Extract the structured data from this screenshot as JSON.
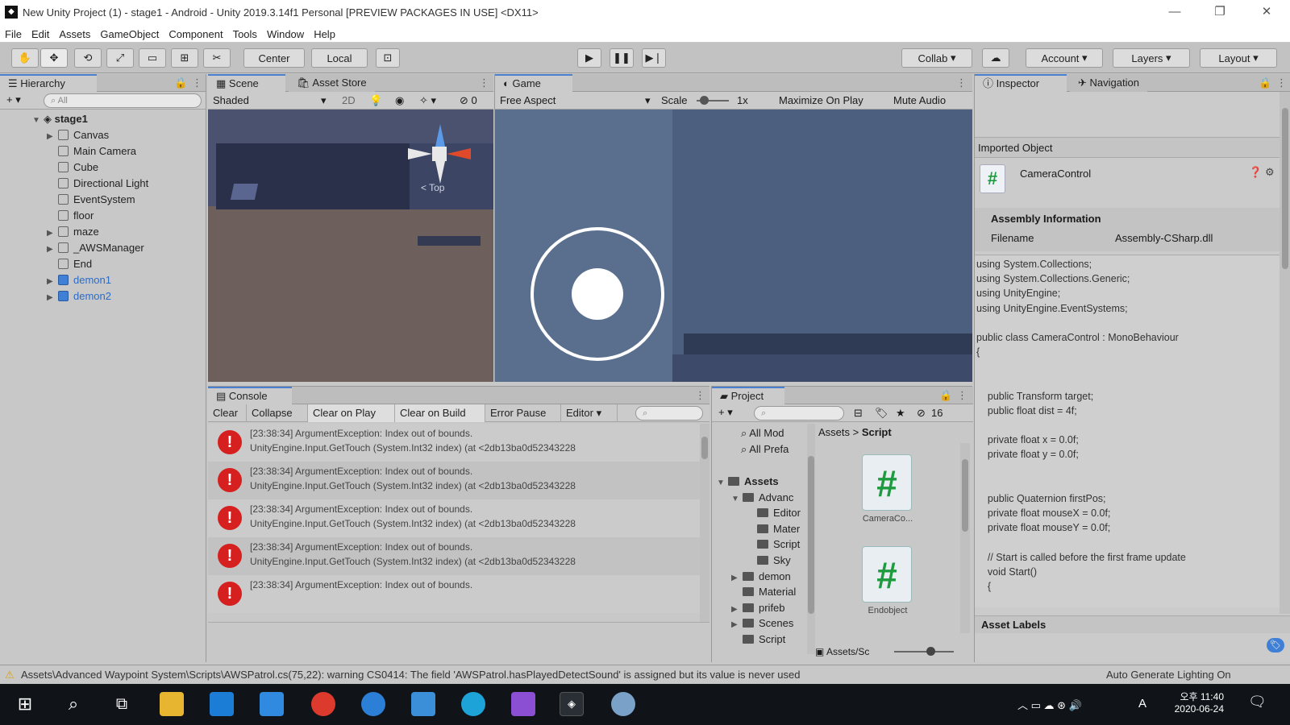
{
  "window": {
    "title": "New Unity Project (1) - stage1 - Android - Unity 2019.3.14f1 Personal [PREVIEW PACKAGES IN USE] <DX11>"
  },
  "menu": [
    "File",
    "Edit",
    "Assets",
    "GameObject",
    "Component",
    "Tools",
    "Window",
    "Help"
  ],
  "toolbar": {
    "center_label": "Center",
    "local_label": "Local",
    "collab_label": "Collab",
    "account_label": "Account",
    "layers_label": "Layers",
    "layout_label": "Layout"
  },
  "hierarchy": {
    "tab": "Hierarchy",
    "search_placeholder": "All",
    "scene_name": "stage1",
    "items": [
      {
        "label": "Canvas",
        "expandable": true
      },
      {
        "label": "Main Camera",
        "expandable": false
      },
      {
        "label": "Cube",
        "expandable": false
      },
      {
        "label": "Directional Light",
        "expandable": false
      },
      {
        "label": "EventSystem",
        "expandable": false
      },
      {
        "label": "floor",
        "expandable": false
      },
      {
        "label": "maze",
        "expandable": true
      },
      {
        "label": "_AWSManager",
        "expandable": true
      },
      {
        "label": "End",
        "expandable": false
      },
      {
        "label": "demon1",
        "expandable": true,
        "prefab": true
      },
      {
        "label": "demon2",
        "expandable": true,
        "prefab": true
      }
    ]
  },
  "scene": {
    "tab_scene": "Scene",
    "tab_asset_store": "Asset Store",
    "shading": "Shaded",
    "mode_2d": "2D",
    "gizmo_label": "< Top"
  },
  "game": {
    "tab": "Game",
    "aspect": "Free Aspect",
    "scale_label": "Scale",
    "scale_value": "1x",
    "maximize": "Maximize On Play",
    "mute": "Mute Audio"
  },
  "inspector": {
    "tab_inspector": "Inspector",
    "tab_navigation": "Navigation",
    "imported_object": "Imported Object",
    "object_name": "CameraControl",
    "assembly_header": "Assembly Information",
    "filename_label": "Filename",
    "filename_value": "Assembly-CSharp.dll",
    "code_lines": [
      "using System.Collections;",
      "using System.Collections.Generic;",
      "using UnityEngine;",
      "using UnityEngine.EventSystems;",
      "",
      "public class CameraControl : MonoBehaviour",
      "{",
      "",
      "",
      "    public Transform target;",
      "    public float dist = 4f;",
      "",
      "    private float x = 0.0f;",
      "    private float y = 0.0f;",
      "",
      "",
      "    public Quaternion firstPos;",
      "    private float mouseX = 0.0f;",
      "    private float mouseY = 0.0f;",
      "",
      "    // Start is called before the first frame update",
      "    void Start()",
      "    {"
    ],
    "asset_labels": "Asset Labels"
  },
  "console": {
    "tab": "Console",
    "buttons": [
      "Clear",
      "Collapse",
      "Clear on Play",
      "Clear on Build",
      "Error Pause",
      "Editor"
    ],
    "messages": [
      {
        "line1": "[23:38:34] ArgumentException: Index out of bounds.",
        "line2": "UnityEngine.Input.GetTouch (System.Int32 index) (at <2db13ba0d52343228"
      },
      {
        "line1": "[23:38:34] ArgumentException: Index out of bounds.",
        "line2": "UnityEngine.Input.GetTouch (System.Int32 index) (at <2db13ba0d52343228"
      },
      {
        "line1": "[23:38:34] ArgumentException: Index out of bounds.",
        "line2": "UnityEngine.Input.GetTouch (System.Int32 index) (at <2db13ba0d52343228"
      },
      {
        "line1": "[23:38:34] ArgumentException: Index out of bounds.",
        "line2": "UnityEngine.Input.GetTouch (System.Int32 index) (at <2db13ba0d52343228"
      },
      {
        "line1": "[23:38:34] ArgumentException: Index out of bounds.",
        "line2": ""
      }
    ]
  },
  "project": {
    "tab": "Project",
    "count_badge": "16",
    "favorites": [
      "All Mod",
      "All Prefa"
    ],
    "tree": [
      {
        "label": "Assets",
        "indent": 0,
        "arrow": "open",
        "bold": true
      },
      {
        "label": "Advanc",
        "indent": 1,
        "arrow": "open"
      },
      {
        "label": "Editor",
        "indent": 2,
        "arrow": ""
      },
      {
        "label": "Mater",
        "indent": 2,
        "arrow": ""
      },
      {
        "label": "Script",
        "indent": 2,
        "arrow": ""
      },
      {
        "label": "Sky",
        "indent": 2,
        "arrow": ""
      },
      {
        "label": "demon",
        "indent": 1,
        "arrow": "closed"
      },
      {
        "label": "Material",
        "indent": 1,
        "arrow": ""
      },
      {
        "label": "prifeb",
        "indent": 1,
        "arrow": "closed"
      },
      {
        "label": "Scenes",
        "indent": 1,
        "arrow": "closed"
      },
      {
        "label": "Script",
        "indent": 1,
        "arrow": ""
      }
    ],
    "breadcrumb_root": "Assets",
    "breadcrumb_sep": ">",
    "breadcrumb_leaf": "Script",
    "files": [
      {
        "label": "CameraCo...",
        "icon": "#"
      },
      {
        "label": "Endobject",
        "icon": "#"
      }
    ],
    "footer_label": "Assets/Sc"
  },
  "status": {
    "warning": "Assets\\Advanced Waypoint System\\Scripts\\AWSPatrol.cs(75,22): warning CS0414: The field 'AWSPatrol.hasPlayedDetectSound' is assigned but its value is never used",
    "right": "Auto Generate Lighting On"
  },
  "taskbar": {
    "time": "오후 11:40",
    "date": "2020-06-24",
    "ime": "A"
  },
  "colors": {
    "accent": "#4a7fd0",
    "error": "#d61f1f",
    "script_green": "#1e9b3e",
    "prefab_blue": "#2d6cc4"
  }
}
